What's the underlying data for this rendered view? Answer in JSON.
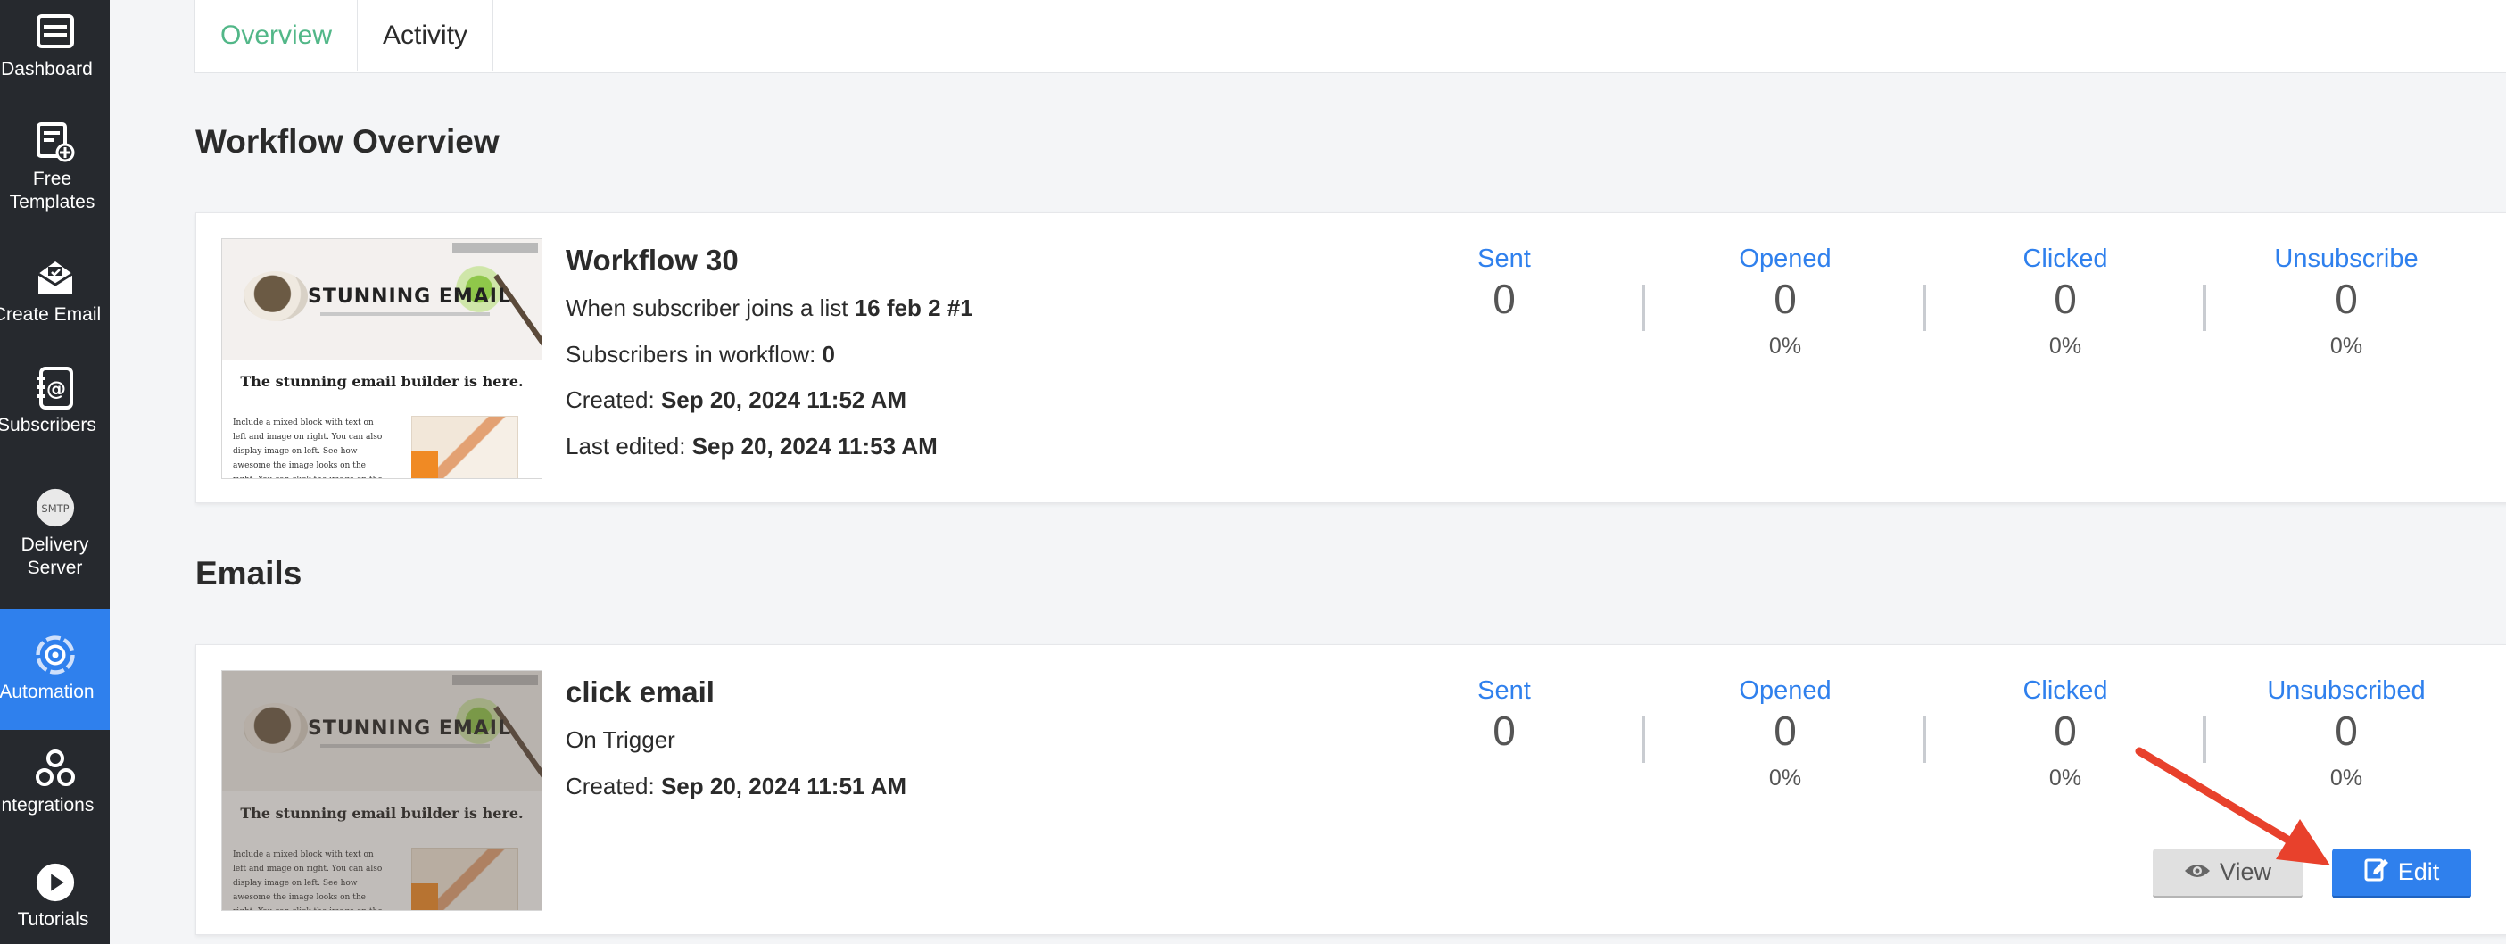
{
  "sidebar": {
    "items": [
      {
        "label": "Dashboard",
        "icon": "dashboard-icon"
      },
      {
        "label": "Free",
        "label2": "Templates",
        "icon": "templates-icon"
      },
      {
        "label": "Create Email",
        "icon": "create-email-icon"
      },
      {
        "label": "Subscribers",
        "icon": "subscribers-icon"
      },
      {
        "label": "Delivery",
        "label2": "Server",
        "icon": "smtp-icon",
        "icon_text": "SMTP"
      },
      {
        "label": "Automation",
        "icon": "automation-icon",
        "active": true
      },
      {
        "label": "Integrations",
        "icon": "integrations-icon"
      },
      {
        "label": "Tutorials",
        "icon": "play-icon"
      }
    ]
  },
  "tabs": [
    {
      "label": "Overview",
      "active": true
    },
    {
      "label": "Activity",
      "active": false
    }
  ],
  "workflow_section_title": "Workflow Overview",
  "workflow": {
    "name": "Workflow 30",
    "trigger_prefix": "When subscriber joins a list",
    "trigger_list": "16 feb 2 #1",
    "subscribers_prefix": "Subscribers in workflow:",
    "subscribers_count": "0",
    "created_prefix": "Created:",
    "created": "Sep 20, 2024 11:52 AM",
    "edited_prefix": "Last edited:",
    "edited": "Sep 20, 2024 11:53 AM",
    "stats": {
      "sent_label": "Sent",
      "sent": "0",
      "opened_label": "Opened",
      "opened": "0",
      "opened_pct": "0%",
      "clicked_label": "Clicked",
      "clicked": "0",
      "clicked_pct": "0%",
      "unsub_label": "Unsubscribe",
      "unsub": "0",
      "unsub_pct": "0%"
    }
  },
  "emails_section_title": "Emails",
  "email": {
    "name": "click email",
    "trigger": "On Trigger",
    "created_prefix": "Created:",
    "created": "Sep 20, 2024 11:51 AM",
    "stats": {
      "sent_label": "Sent",
      "sent": "0",
      "opened_label": "Opened",
      "opened": "0",
      "opened_pct": "0%",
      "clicked_label": "Clicked",
      "clicked": "0",
      "clicked_pct": "0%",
      "unsub_label": "Unsubscribed",
      "unsub": "0",
      "unsub_pct": "0%"
    },
    "view_label": "View",
    "edit_label": "Edit"
  },
  "thumbnail": {
    "title": "STUNNING EMAIL",
    "headline": "The stunning email builder is here.",
    "body": "Include a mixed block with text on left and image on right. You can also display image on left. See how awesome the image looks on the right. You can click the image on the right"
  },
  "colors": {
    "accent": "#2f80ed",
    "active_tab": "#52b788",
    "sidebar_bg": "#26292e",
    "annotation_arrow": "#e8412c"
  }
}
